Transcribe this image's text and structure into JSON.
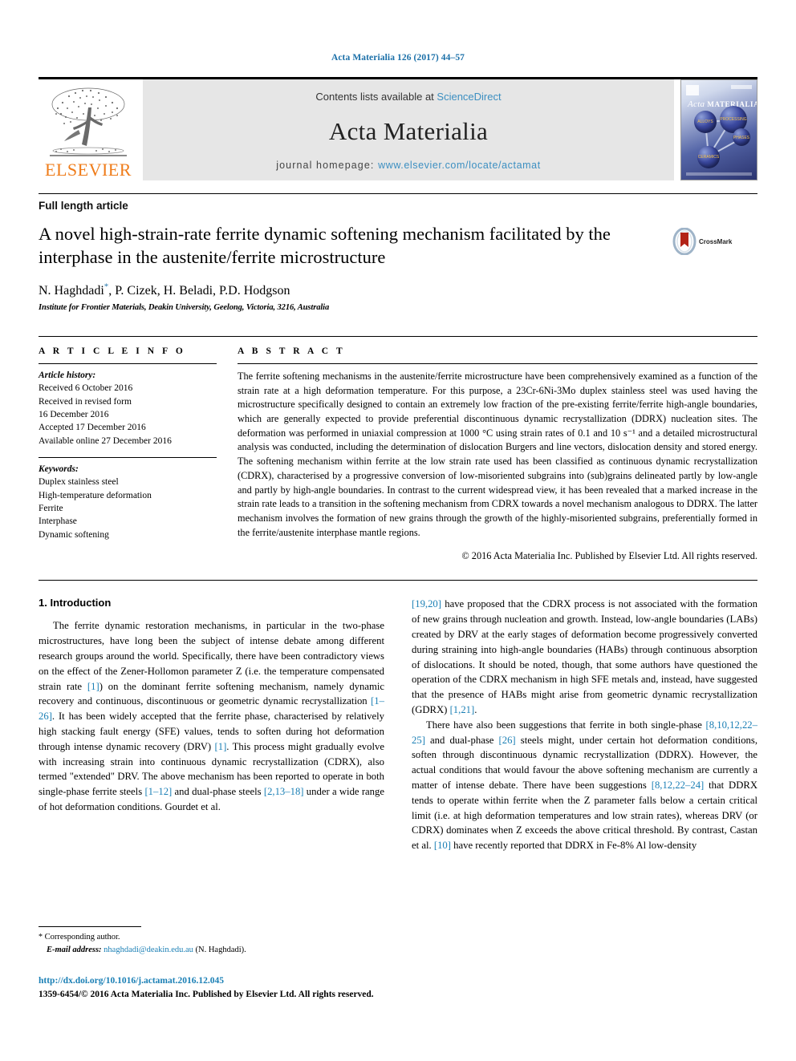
{
  "running_head": "Acta Materialia 126 (2017) 44–57",
  "masthead": {
    "contents_prefix": "Contents lists available at ",
    "sciencedirect": "ScienceDirect",
    "journal_title": "Acta Materialia",
    "homepage_prefix": "journal homepage: ",
    "homepage_url": "www.elsevier.com/locate/actamat",
    "publisher_logo_text": "ELSEVIER",
    "cover_title_italic": "Acta",
    "cover_title_caps": "MATERIALIA",
    "cover_node_labels": [
      "ALLOYS",
      "PROCESSING",
      "PHASES",
      "CERAMICS"
    ]
  },
  "article_type": "Full length article",
  "title": "A novel high-strain-rate ferrite dynamic softening mechanism facilitated by the interphase in the austenite/ferrite microstructure",
  "authors": "N. Haghdadi, P. Cizek, H. Beladi, P.D. Hodgson",
  "author_marker": "*",
  "affiliation": "Institute for Frontier Materials, Deakin University, Geelong, Victoria, 3216, Australia",
  "crossmark_label": "CrossMark",
  "article_info": {
    "heading": "A R T I C L E   I N F O",
    "history_label": "Article history:",
    "history": [
      "Received 6 October 2016",
      "Received in revised form",
      "16 December 2016",
      "Accepted 17 December 2016",
      "Available online 27 December 2016"
    ],
    "keywords_label": "Keywords:",
    "keywords": [
      "Duplex stainless steel",
      "High-temperature deformation",
      "Ferrite",
      "Interphase",
      "Dynamic softening"
    ]
  },
  "abstract": {
    "heading": "A B S T R A C T",
    "text": "The ferrite softening mechanisms in the austenite/ferrite microstructure have been comprehensively examined as a function of the strain rate at a high deformation temperature. For this purpose, a 23Cr-6Ni-3Mo duplex stainless steel was used having the microstructure specifically designed to contain an extremely low fraction of the pre-existing ferrite/ferrite high-angle boundaries, which are generally expected to provide preferential discontinuous dynamic recrystallization (DDRX) nucleation sites. The deformation was performed in uniaxial compression at 1000 °C using strain rates of 0.1 and 10 s⁻¹ and a detailed microstructural analysis was conducted, including the determination of dislocation Burgers and line vectors, dislocation density and stored energy. The softening mechanism within ferrite at the low strain rate used has been classified as continuous dynamic recrystallization (CDRX), characterised by a progressive conversion of low-misoriented subgrains into (sub)grains delineated partly by low-angle and partly by high-angle boundaries. In contrast to the current widespread view, it has been revealed that a marked increase in the strain rate leads to a transition in the softening mechanism from CDRX towards a novel mechanism analogous to DDRX. The latter mechanism involves the formation of new grains through the growth of the highly-misoriented subgrains, preferentially formed in the ferrite/austenite interphase mantle regions.",
    "copyright": "© 2016 Acta Materialia Inc. Published by Elsevier Ltd. All rights reserved."
  },
  "body": {
    "section_number_title": "1. Introduction",
    "left_paragraph_1_a": "The ferrite dynamic restoration mechanisms, in particular in the two-phase microstructures, have long been the subject of intense debate among different research groups around the world. Specifically, there have been contradictory views on the effect of the Zener-Hollomon parameter Z (i.e. the temperature compensated strain rate ",
    "ref_1": "[1]",
    "left_paragraph_1_b": ") on the dominant ferrite softening mechanism, namely dynamic recovery and continuous, discontinuous or geometric dynamic recrystallization ",
    "ref_1_26": "[1–26]",
    "left_paragraph_1_c": ". It has been widely accepted that the ferrite phase, characterised by relatively high stacking fault energy (SFE) values, tends to soften during hot deformation through intense dynamic recovery (DRV) ",
    "ref_1_b": "[1]",
    "left_paragraph_1_d": ". This process might gradually evolve with increasing strain into continuous dynamic recrystallization (CDRX), also termed \"extended\" DRV. The above mechanism has been reported to operate in both single-phase ferrite steels ",
    "ref_1_12": "[1–12]",
    "left_paragraph_1_e": " and dual-phase steels ",
    "ref_2_13_18": "[2,13–18]",
    "left_paragraph_1_f": " under a wide range of hot deformation conditions. Gourdet et al.",
    "right_ref_19_20": "[19,20]",
    "right_paragraph_1": " have proposed that the CDRX process is not associated with the formation of new grains through nucleation and growth. Instead, low-angle boundaries (LABs) created by DRV at the early stages of deformation become progressively converted during straining into high-angle boundaries (HABs) through continuous absorption of dislocations. It should be noted, though, that some authors have questioned the operation of the CDRX mechanism in high SFE metals and, instead, have suggested that the presence of HABs might arise from geometric dynamic recrystallization (GDRX) ",
    "ref_1_21": "[1,21]",
    "right_paragraph_1_end": ".",
    "right_paragraph_2_a": "There have also been suggestions that ferrite in both single-phase ",
    "ref_8_10_12_22_25": "[8,10,12,22–25]",
    "right_paragraph_2_b": " and dual-phase ",
    "ref_26": "[26]",
    "right_paragraph_2_c": " steels might, under certain hot deformation conditions, soften through discontinuous dynamic recrystallization (DDRX). However, the actual conditions that would favour the above softening mechanism are currently a matter of intense debate. There have been suggestions ",
    "ref_8_12_22_24": "[8,12,22–24]",
    "right_paragraph_2_d": " that DDRX tends to operate within ferrite when the Z parameter falls below a certain critical limit (i.e. at high deformation temperatures and low strain rates), whereas DRV (or CDRX) dominates when Z exceeds the above critical threshold. By contrast, Castan et al. ",
    "ref_10": "[10]",
    "right_paragraph_2_e": " have recently reported that DDRX in Fe-8% Al low-density"
  },
  "footnote": {
    "star": "*",
    "corresponding": "Corresponding author.",
    "email_label": "E-mail address:",
    "email": "nhaghdadi@deakin.edu.au",
    "email_suffix": "(N. Haghdadi)."
  },
  "doi": "http://dx.doi.org/10.1016/j.actamat.2016.12.045",
  "issn_line": "1359-6454/© 2016 Acta Materialia Inc. Published by Elsevier Ltd. All rights reserved.",
  "colors": {
    "link": "#1a7fb5",
    "masthead_link": "#3c8fc1",
    "elsevier_orange": "#ef7c1a",
    "running_head": "#1a6fa8"
  }
}
